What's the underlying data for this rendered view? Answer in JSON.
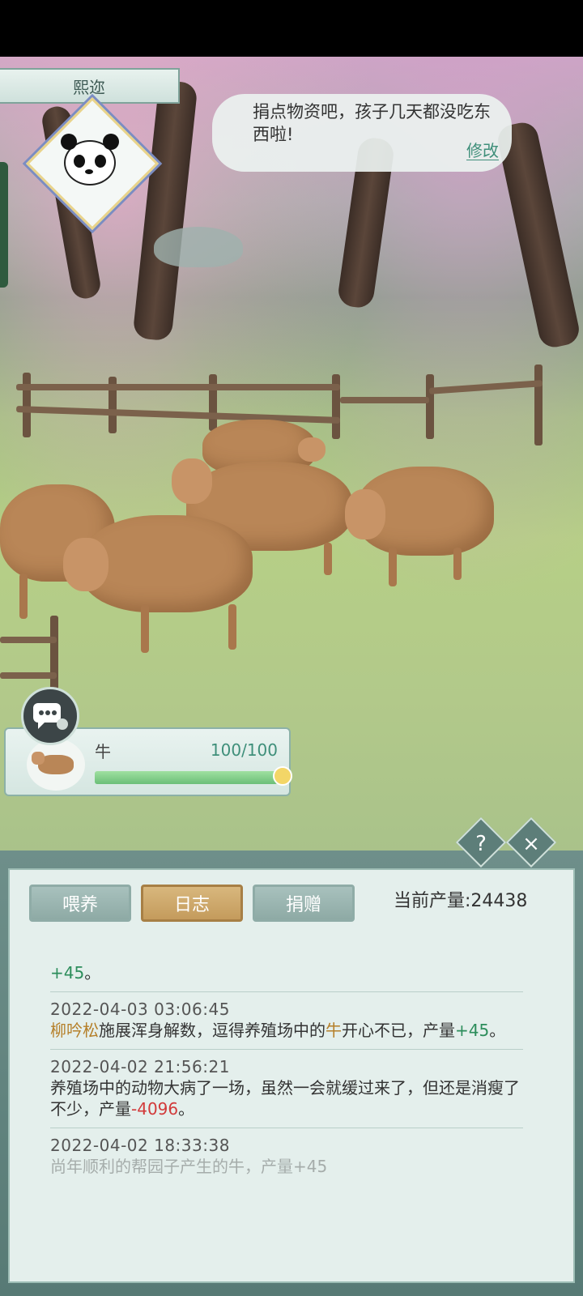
{
  "npc": {
    "name": "熙迩",
    "message": "捐点物资吧，孩子几天都没吃东西啦!",
    "edit_label": "修改"
  },
  "animal": {
    "name": "牛",
    "count": "100/100",
    "fill_fraction": 1.0
  },
  "panel": {
    "tabs": [
      "喂养",
      "日志",
      "捐赠"
    ],
    "active_tab": "日志",
    "production_label": "当前产量:24438",
    "help_icon": "?",
    "close_icon": "×"
  },
  "log": [
    {
      "text_parts": [
        {
          "t": "+45",
          "c": "green"
        },
        {
          "t": "。",
          "c": ""
        }
      ]
    },
    {
      "timestamp": "2022-04-03   03:06:45",
      "text_parts": [
        {
          "t": "柳吟松",
          "c": "gold"
        },
        {
          "t": "施展浑身解数，逗得养殖场中的",
          "c": ""
        },
        {
          "t": "牛",
          "c": "gold"
        },
        {
          "t": "开心不已，产量",
          "c": ""
        },
        {
          "t": "+45",
          "c": "green"
        },
        {
          "t": "。",
          "c": ""
        }
      ]
    },
    {
      "timestamp": "2022-04-02   21:56:21",
      "text_parts": [
        {
          "t": "养殖场中的动物大病了一场，虽然一会就缓过来了，但还是消瘦了不少，产量",
          "c": ""
        },
        {
          "t": "-4096",
          "c": "red"
        },
        {
          "t": "。",
          "c": ""
        }
      ]
    },
    {
      "timestamp": "2022-04-02   18:33:38",
      "text_parts": [
        {
          "t": "尚年顺利的帮园子产生的牛，产量+45",
          "c": ""
        }
      ]
    }
  ]
}
